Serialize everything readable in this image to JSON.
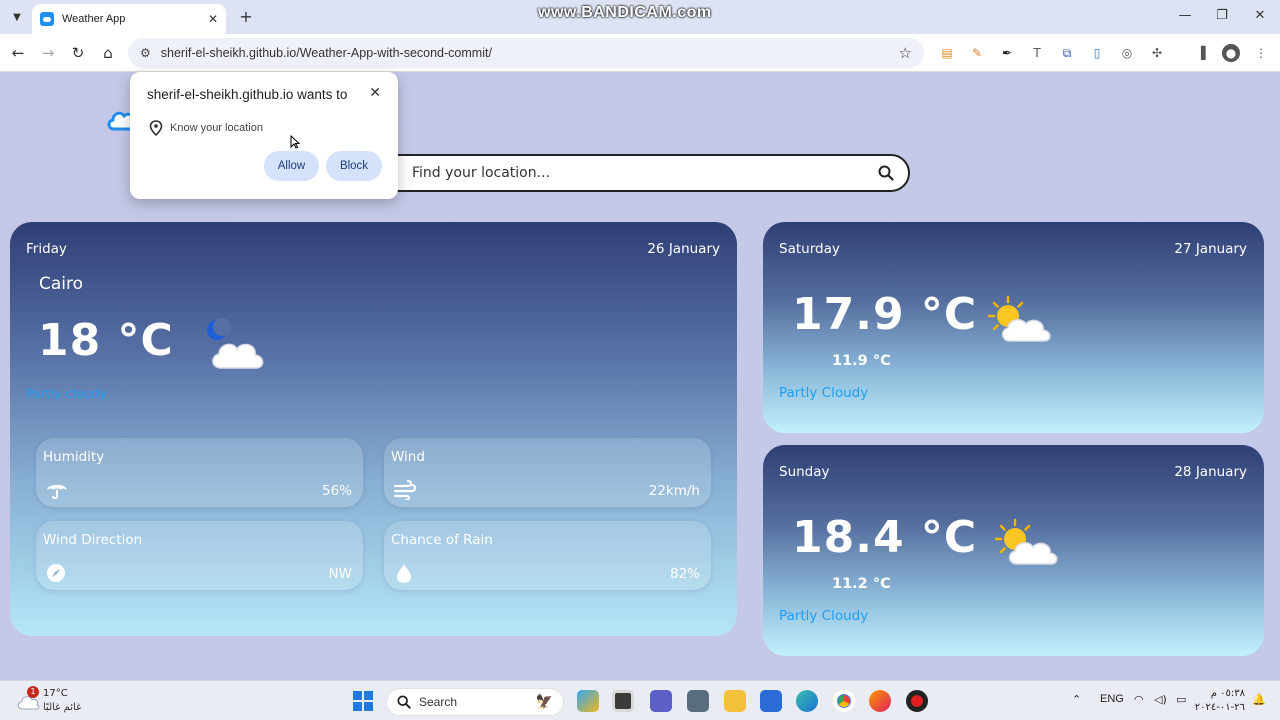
{
  "browser": {
    "tab_title": "Weather App",
    "tab_close": "✕",
    "new_tab": "+",
    "watermark": "www.BANDICAM.com",
    "url": "sherif-el-sheikh.github.io/Weather-App-with-second-commit/"
  },
  "popup": {
    "title": "sherif-el-sheikh.github.io wants to",
    "permission": "Know your location",
    "allow_label": "Allow",
    "block_label": "Block",
    "close": "✕"
  },
  "search": {
    "placeholder": "Find your location..."
  },
  "today": {
    "day": "Friday",
    "date": "26 January",
    "city": "Cairo",
    "temp": "18 °C",
    "condition": "Partly cloudy",
    "metrics": [
      {
        "label": "Humidity",
        "value": "56%",
        "icon": "umbrella-icon"
      },
      {
        "label": "Wind",
        "value": "22km/h",
        "icon": "wind-icon"
      },
      {
        "label": "Wind Direction",
        "value": "NW",
        "icon": "compass-icon"
      },
      {
        "label": "Chance of Rain",
        "value": "82%",
        "icon": "raindrop-icon"
      }
    ]
  },
  "forecast": [
    {
      "day": "Saturday",
      "date": "27 January",
      "max": "17.9 °C",
      "min": "11.9 °C",
      "condition": "Partly Cloudy"
    },
    {
      "day": "Sunday",
      "date": "28 January",
      "max": "18.4 °C",
      "min": "11.2 °C",
      "condition": "Partly Cloudy"
    }
  ],
  "taskbar": {
    "weather_badge": "1",
    "weather_temp": "17°C",
    "weather_condition": "غائم غالبًا",
    "search_label": "Search",
    "language": "ENG",
    "time": "٠٥:٣٨ م",
    "date": "٢٦-٠١-٢٠٢٤"
  },
  "colors": {
    "condition_text": "#1e9ef0",
    "popup_button": "#d4e3fb",
    "card_top": "#2f3f75",
    "card_bottom": "#b6e6f7"
  }
}
